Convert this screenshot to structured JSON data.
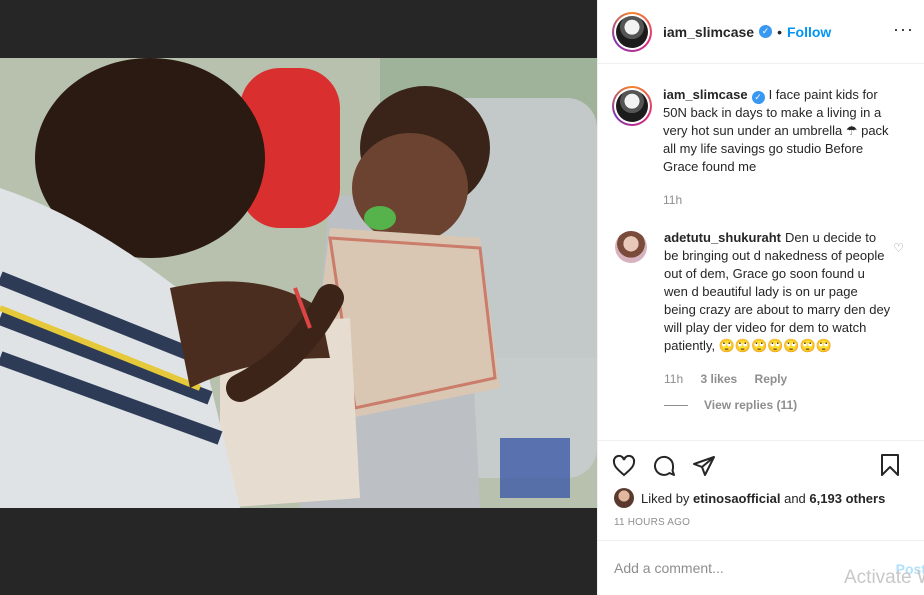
{
  "post": {
    "username": "iam_slimcase",
    "follow_label": "Follow",
    "dot": "•",
    "verified_icon": "✓",
    "caption": "I face paint kids for 50N back in days to make a living in a very hot sun under an umbrella ☂ pack all my life savings go studio Before Grace found me",
    "caption_time": "11h"
  },
  "comments": [
    {
      "username": "adetutu_shukuraht",
      "text": "Den u decide to be bringing out d nakedness of people out of dem, Grace go soon found u wen d beautiful lady is on ur page being crazy are about to marry den dey will play der video for dem to watch patiently, 🙄🙄🙄🙄🙄🙄🙄",
      "time": "11h",
      "likes": "3 likes",
      "reply_label": "Reply",
      "view_replies": "View replies (11)"
    }
  ],
  "likes": {
    "prefix": "Liked by",
    "user": "etinosaofficial",
    "middle": "and",
    "others": "6,193 others"
  },
  "post_time": "11 HOURS AGO",
  "add_comment": {
    "placeholder": "Add a comment...",
    "post_label": "Post"
  },
  "watermark": "Activate W",
  "colors": {
    "link": "#0095f6",
    "post_disabled": "#b2dffc",
    "muted": "#8e8e8e",
    "verified": "#3897f0"
  },
  "icons": [
    "more-options-icon",
    "heart-icon",
    "comment-icon",
    "share-icon",
    "bookmark-icon",
    "verified-icon",
    "comment-like-icon"
  ]
}
